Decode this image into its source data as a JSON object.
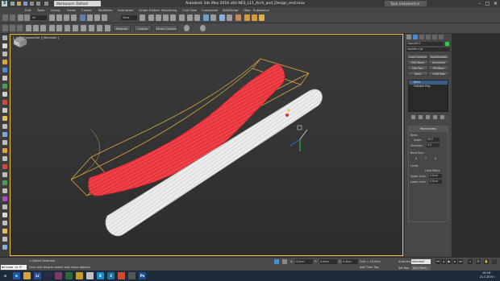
{
  "title_bar": {
    "logo_text": "3",
    "workspace": "Workspace: Default",
    "window_title": "Autodesk 3ds Max  2016 x64     NES_L11_Arch_and_Design_end.max",
    "search_placeholder": "Type a keyword or phrase",
    "minimize": "–",
    "maximize": "□",
    "close": "✕"
  },
  "menubar": {
    "items": [
      "Edit",
      "Tools",
      "Group",
      "Views",
      "Create",
      "Modifiers",
      "Animation",
      "Graph Editors",
      "Rendering",
      "Civil View",
      "Customize",
      "MAXScript",
      "Help",
      "Substance"
    ]
  },
  "toolbar": {
    "selection_filter": "All",
    "reference_coord": "View"
  },
  "ribbon": {
    "buttons": [
      "Measure",
      "Cleaner",
      "Edraw Convert"
    ]
  },
  "viewport": {
    "label": "[ + ] [Perspective ] [Realistic ]"
  },
  "command_panel": {
    "object_name": "Object001",
    "modifier_list": "Modifier List",
    "quick_buttons": [
      "Quad Chamfer",
      "TurboSmooth",
      "Edit Mesh",
      "Symmetry",
      "Edit Poly",
      "FFD(Box)",
      "Shell",
      "UVW Map"
    ],
    "stack": [
      "Bend",
      "Editable Poly"
    ],
    "params_title": "Parameters",
    "bend_group": "Bend:",
    "angle_label": "Angle:",
    "angle_value": "90.0",
    "direction_label": "Direction:",
    "direction_value": "0.0",
    "bend_axis_label": "Bend Axis:",
    "axis_x": "X",
    "axis_y": "Y",
    "axis_z": "Z",
    "limits_label": "Limits",
    "limit_effect": "Limit Effect",
    "upper_limit_label": "Upper Limit:",
    "upper_limit_value": "0.0cm",
    "lower_limit_label": "Lower Limit:",
    "lower_limit_value": "0.0cm"
  },
  "status_bar": {
    "maxscript_text": "Welcome to M",
    "selected_count": "1 Object Selected",
    "prompt": "Click and drag to select and move objects",
    "x_label": "X:",
    "x_value": "0.0cm",
    "y_label": "Y:",
    "y_value": "0.0cm",
    "z_label": "Z:",
    "z_value": "0.0cm",
    "grid": "Grid = 10.0cm",
    "add_time_tag": "Add Time Tag",
    "auto_key": "Auto Key",
    "set_key": "Set Key",
    "selected_dropdown": "Selected",
    "key_filters": "Key Filters..."
  },
  "taskbar": {
    "time": "18:16",
    "date": "21.3.2019 r."
  },
  "colors": {
    "selection_box": "#d9a640",
    "red_object": "#e8353d",
    "white_object": "#ececec",
    "viewport_border": "#f0c040"
  }
}
